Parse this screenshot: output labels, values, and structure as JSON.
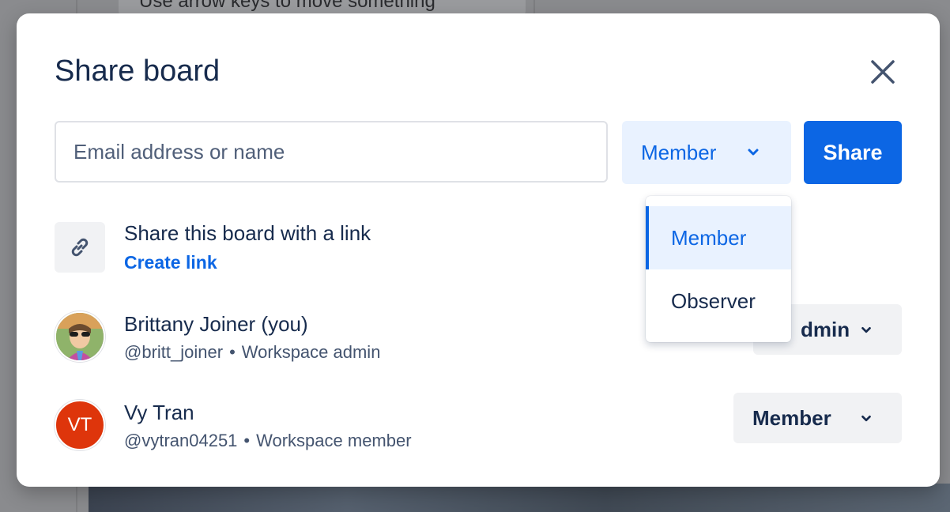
{
  "background": {
    "card_text_1": "Use arrow keys to move something"
  },
  "dialog": {
    "title": "Share board",
    "close_label": "Close"
  },
  "invite": {
    "email_placeholder": "Email address or name",
    "role_selected": "Member",
    "share_label": "Share"
  },
  "role_dropdown": {
    "options": [
      {
        "label": "Member",
        "selected": true
      },
      {
        "label": "Observer",
        "selected": false
      }
    ]
  },
  "link_share": {
    "title": "Share this board with a link",
    "action": "Create link"
  },
  "members": [
    {
      "name": "Brittany Joiner (you)",
      "username": "@britt_joiner",
      "separator": "•",
      "role_description": "Workspace admin",
      "permission": "Admin",
      "permission_visible": "dmin"
    },
    {
      "initials": "VT",
      "name": "Vy Tran",
      "username": "@vytran04251",
      "separator": "•",
      "role_description": "Workspace member",
      "permission": "Member"
    }
  ],
  "colors": {
    "primary": "#0c66e4",
    "text": "#172b4d",
    "subtle": "#44546f",
    "selected_bg": "#e9f2ff",
    "neutral_bg": "#f1f2f4",
    "avatar_vt": "#de350b"
  }
}
